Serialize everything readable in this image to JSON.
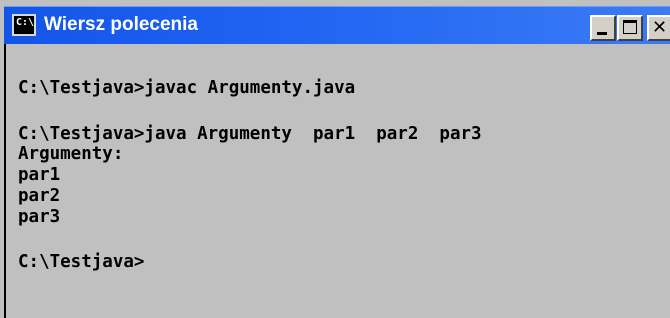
{
  "window": {
    "title": "Wiersz polecenia",
    "icon": "command-prompt-icon",
    "icon_glyph": "C:\\",
    "buttons": {
      "minimize_glyph": "_",
      "maximize_glyph": "□",
      "close_glyph": "✕"
    },
    "colors": {
      "titlebar": "#1e63f2",
      "console_background": "#c0c0c0",
      "console_text": "#000000"
    }
  },
  "console": {
    "lines": [
      "C:\\Testjava>javac Argumenty.java",
      "C:\\Testjava>java Argumenty  par1  par2  par3",
      "Argumenty:",
      "par1",
      "par2",
      "par3",
      "C:\\Testjava>"
    ]
  }
}
